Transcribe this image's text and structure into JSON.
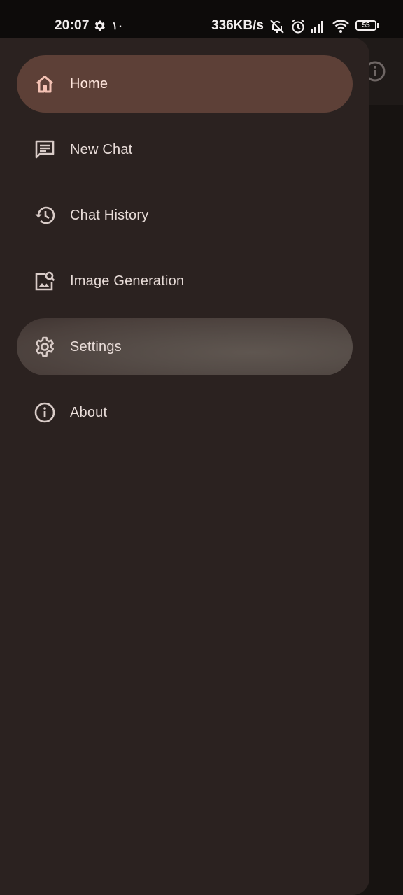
{
  "status_bar": {
    "time": "20:07",
    "extra": "١٠",
    "network_speed": "336KB/s",
    "battery": "55",
    "icons": [
      "gear-icon",
      "bell-off-icon",
      "alarm-icon",
      "signal-icon",
      "wifi-icon",
      "battery-icon"
    ]
  },
  "drawer": {
    "items": [
      {
        "label": "Home",
        "icon": "home-icon",
        "state": "selected"
      },
      {
        "label": "New Chat",
        "icon": "chat-icon",
        "state": "normal"
      },
      {
        "label": "Chat History",
        "icon": "history-icon",
        "state": "normal"
      },
      {
        "label": "Image Generation",
        "icon": "image-search-icon",
        "state": "normal"
      },
      {
        "label": "Settings",
        "icon": "gear-icon",
        "state": "pressed"
      },
      {
        "label": "About",
        "icon": "info-icon",
        "state": "normal"
      }
    ]
  },
  "background_app": {
    "icon": "info-icon"
  },
  "colors": {
    "drawer_bg": "#2b2220",
    "selected_bg": "#5d4037",
    "text": "#e8dcd8",
    "accent_icon": "#f4c2b4"
  }
}
